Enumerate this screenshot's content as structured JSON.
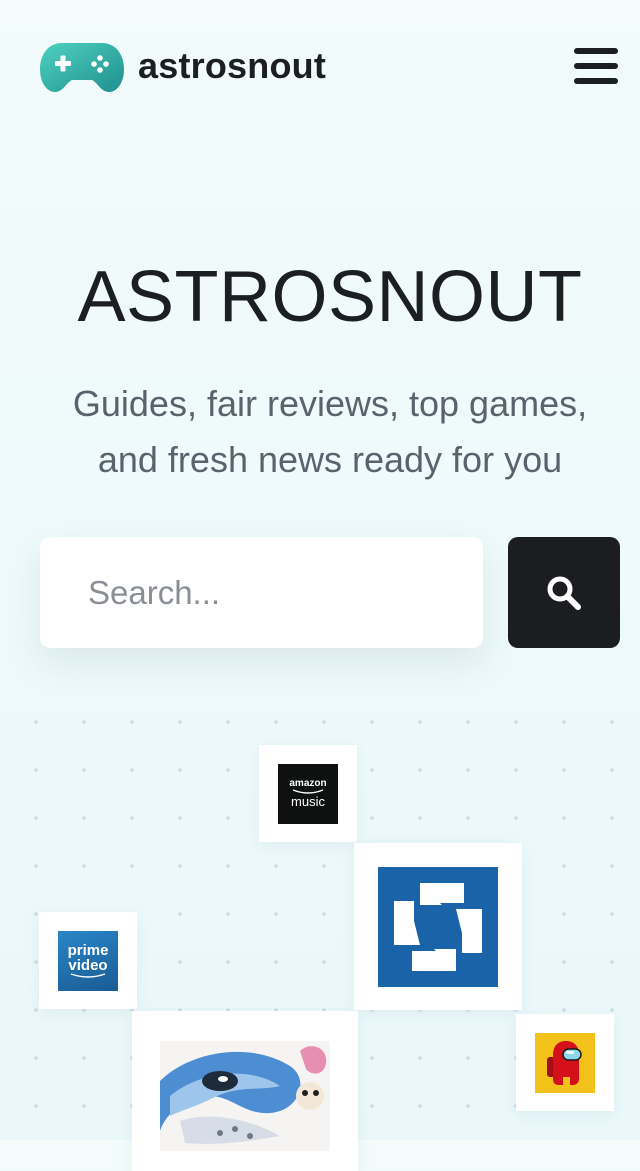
{
  "header": {
    "brand_name": "astrosnout",
    "logo_icon": "gamepad-icon",
    "menu_icon": "hamburger-menu-icon"
  },
  "hero": {
    "title": "ASTROSNOUT",
    "subtitle_lines": [
      "Guides, fair reviews, top games,",
      "and fresh news ready for you"
    ]
  },
  "search": {
    "placeholder": "Search...",
    "button_icon": "search-icon"
  },
  "apps": [
    {
      "id": "amazon-music",
      "lines": [
        "amazon",
        "music"
      ],
      "icon": "amazon-music-icon",
      "bg": "#0f1111",
      "fg": "#ffffff"
    },
    {
      "id": "chase",
      "lines": [],
      "icon": "chase-bank-icon",
      "bg": "#1a63a8",
      "fg": "#ffffff"
    },
    {
      "id": "prime-video",
      "lines": [
        "prime",
        "video"
      ],
      "icon": "prime-video-icon",
      "bg": "#1f6fb0",
      "fg": "#ffffff"
    },
    {
      "id": "among-us",
      "lines": [],
      "icon": "among-us-icon",
      "bg": "#f2c21b",
      "fg": "#d4101a"
    },
    {
      "id": "anime-art",
      "lines": [],
      "icon": "anime-artwork-icon",
      "bg": "#ffffff",
      "fg": "#3d7fc0"
    }
  ],
  "colors": {
    "background": "#eef9fa",
    "text_dark": "#1b1f24",
    "text_muted": "#5a636d",
    "search_button": "#1b1d20",
    "logo_gradient_start": "#44c7b6",
    "logo_gradient_end": "#1f8f8f"
  }
}
